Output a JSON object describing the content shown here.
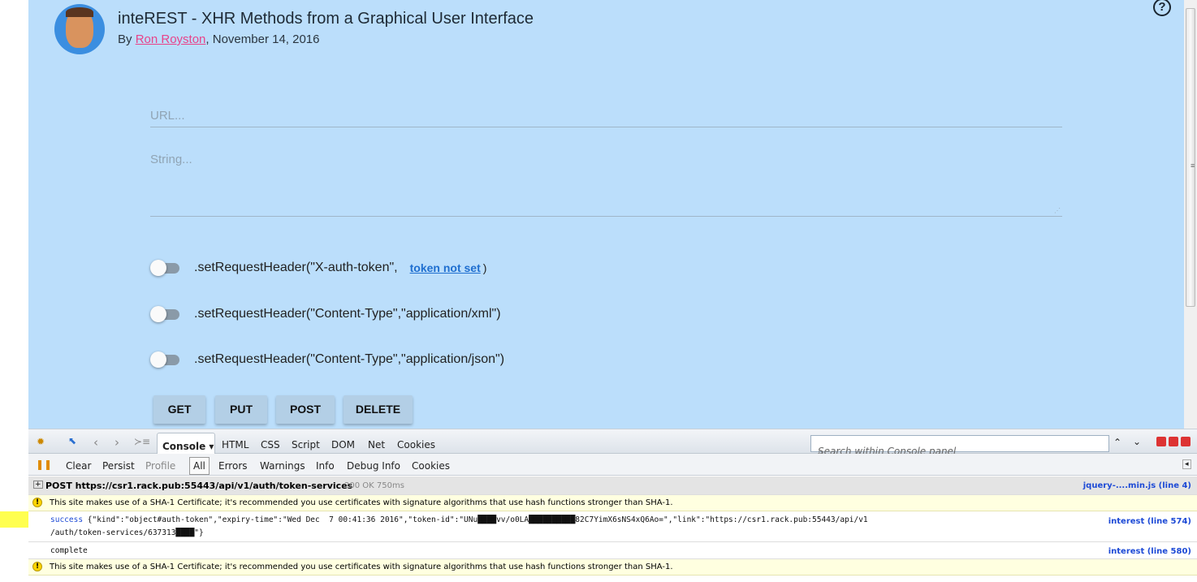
{
  "header": {
    "title": "inteREST - XHR Methods from a Graphical User Interface",
    "by": "By ",
    "author": "Ron Royston",
    "date": ", November 14, 2016",
    "help_icon": "?"
  },
  "form": {
    "url_placeholder": "URL...",
    "string_placeholder": "String..."
  },
  "headers": [
    {
      "label": ".setRequestHeader(\"X-auth-token\",",
      "token": "token not set",
      "suffix": ")",
      "enabled": false
    },
    {
      "label": ".setRequestHeader(\"Content-Type\",\"application/xml\")",
      "enabled": false
    },
    {
      "label": ".setRequestHeader(\"Content-Type\",\"application/json\")",
      "enabled": false
    }
  ],
  "buttons": [
    "GET",
    "PUT",
    "POST",
    "DELETE"
  ],
  "devtools": {
    "tabs": [
      "Console ▾",
      "HTML",
      "CSS",
      "Script",
      "DOM",
      "Net",
      "Cookies"
    ],
    "search_placeholder": "Search within Console panel",
    "toolbar": [
      "Clear",
      "Persist",
      "Profile",
      "All",
      "Errors",
      "Warnings",
      "Info",
      "Debug Info",
      "Cookies"
    ],
    "log": {
      "request": "POST https://csr1.rack.pub:55443/api/v1/auth/token-services",
      "status": "200 OK 750ms",
      "request_src": "jquery-....min.js (line 4)",
      "warning": "This site makes use of a SHA-1 Certificate; it's recommended you use certificates with signature algorithms that use hash functions stronger than SHA-1.",
      "success_label": "success",
      "success_line1": " {\"kind\":\"object#auth-token\",\"expiry-time\":\"Wed Dec  7 00:41:36 2016\",\"token-id\":\"UNu████vv/o0LA██████████82C7YimX6sNS4xQ6Ao=\",\"link\":\"https://csr1.rack.pub:55443/api/v1",
      "success_line2": "/auth/token-services/637313████\"}",
      "success_src": "interest (line 574)",
      "complete": "complete",
      "complete_src": "interest (line 580)"
    }
  },
  "colors": {
    "page_bg": "#bbdefb",
    "author_link": "#e8438a",
    "token_link": "#1f6fd0"
  }
}
